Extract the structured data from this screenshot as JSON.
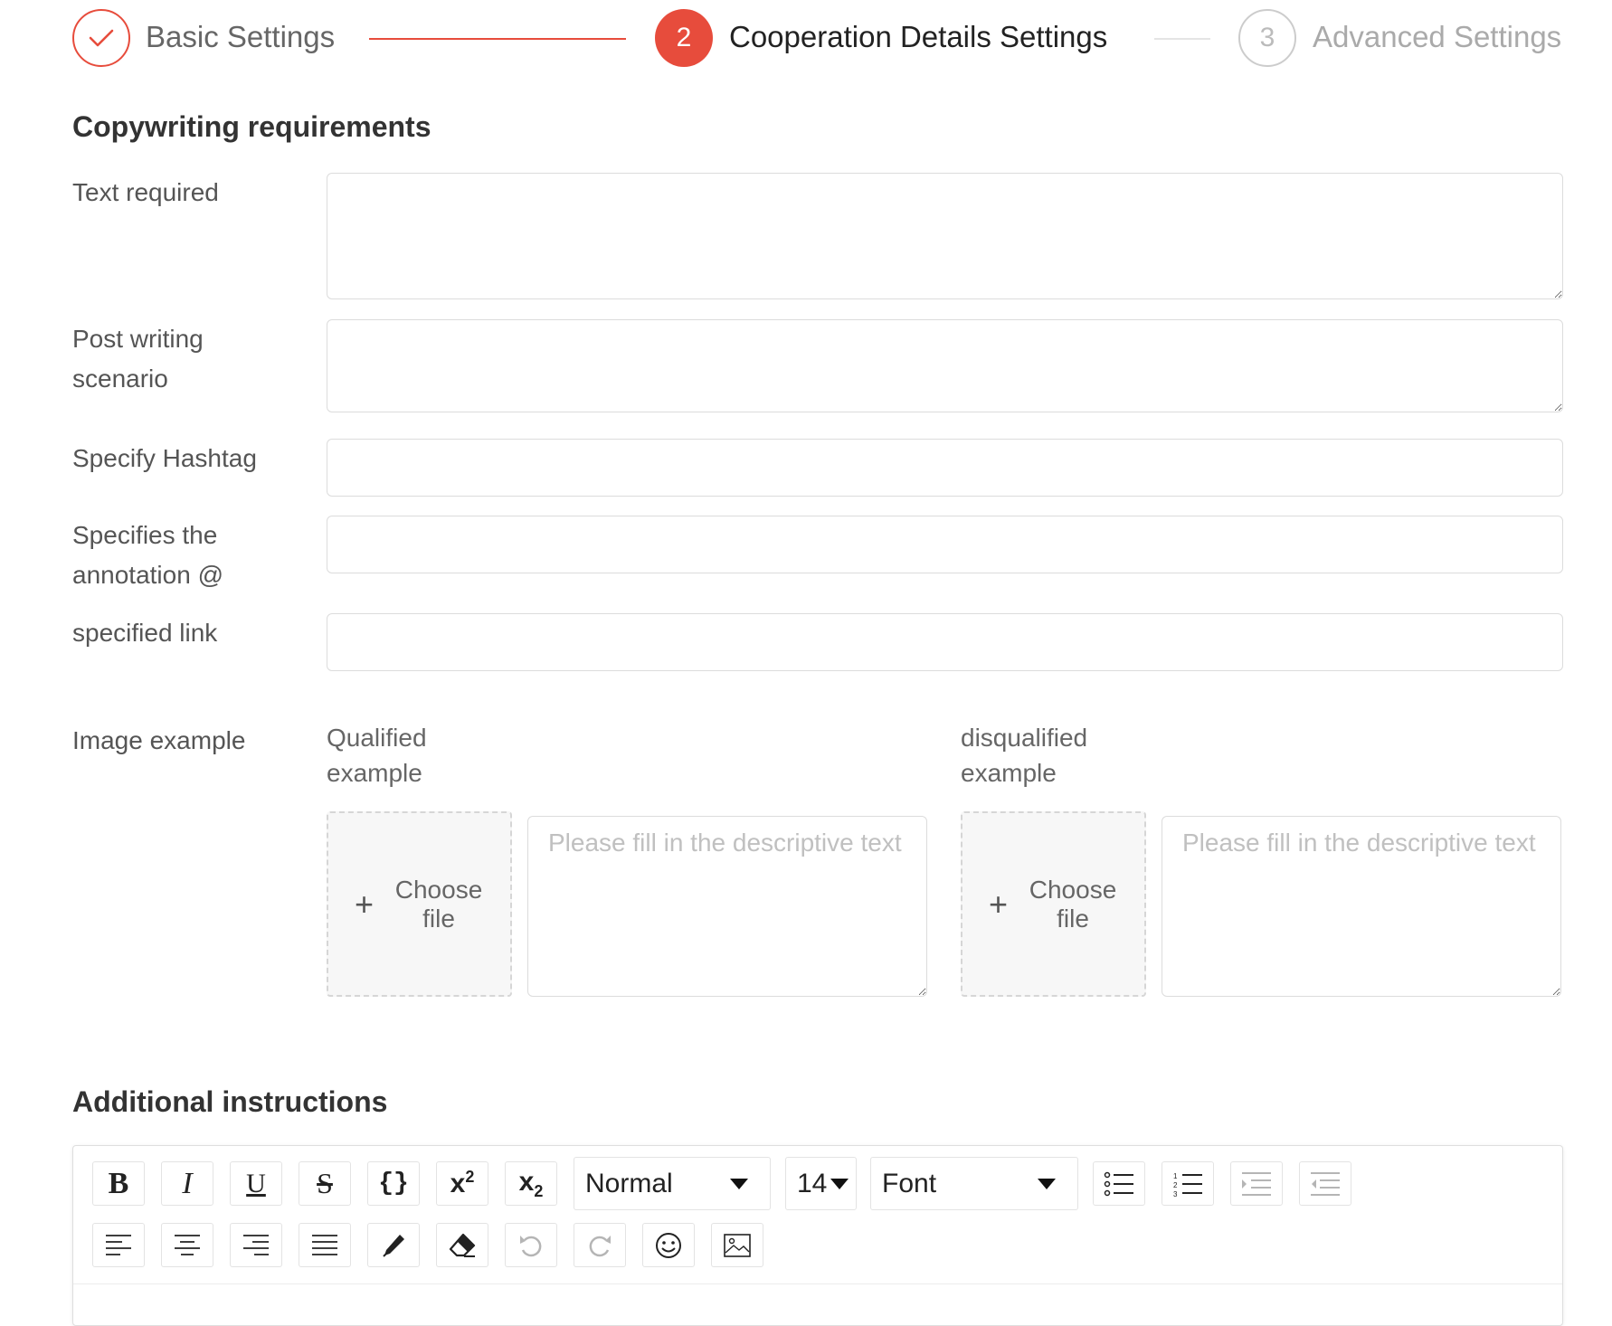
{
  "steps": [
    {
      "number": "1",
      "title": "Basic Settings",
      "state": "done"
    },
    {
      "number": "2",
      "title": "Cooperation Details Settings",
      "state": "active"
    },
    {
      "number": "3",
      "title": "Advanced Settings",
      "state": "todo"
    }
  ],
  "copywriting": {
    "title": "Copywriting requirements",
    "text_required_label": "Text required",
    "post_scenario_label": "Post writing scenario",
    "hashtag_label": "Specify Hashtag",
    "annotation_label": "Specifies the annotation @",
    "link_label": "specified link"
  },
  "image_example": {
    "label": "Image example",
    "qualified_label": "Qualified example",
    "disqualified_label": "disqualified example",
    "choose_file": "Choose file",
    "desc_placeholder": "Please fill in the descriptive text"
  },
  "additional": {
    "title": "Additional instructions",
    "header_select": "Normal",
    "size_select": "14",
    "font_select": "Font"
  },
  "colors": {
    "accent": "#e74c3c",
    "border": "#dcdcdc",
    "placeholder": "#c0c0c0"
  }
}
